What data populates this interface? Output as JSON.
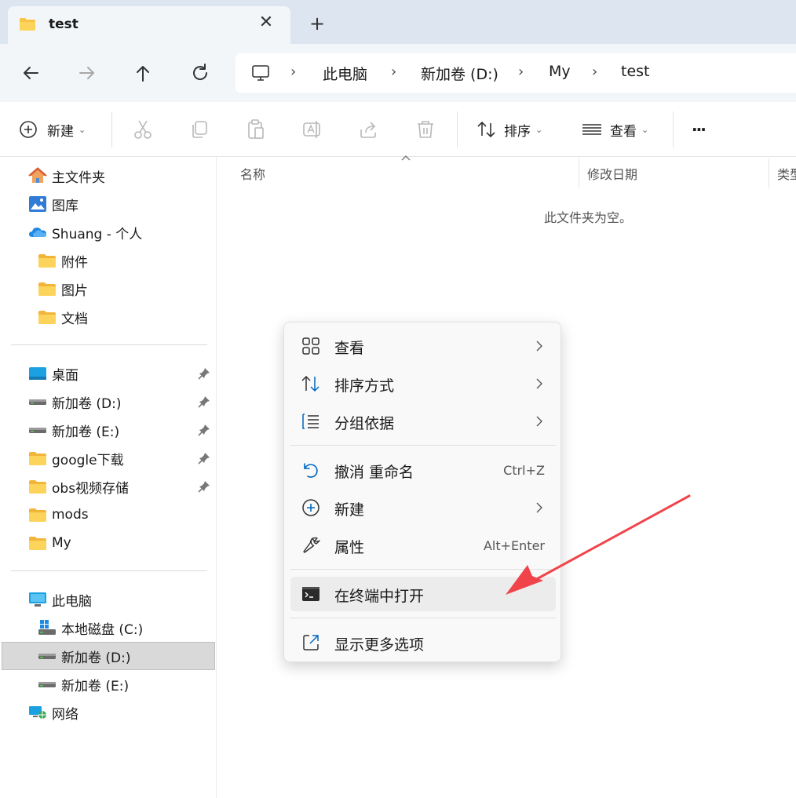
{
  "tab": {
    "title": "test",
    "close": "✕",
    "new": "+"
  },
  "address": {
    "items": [
      "此电脑",
      "新加卷 (D:)",
      "My",
      "test"
    ],
    "separator": "›"
  },
  "toolbar": {
    "new_label": "新建",
    "sort_label": "排序",
    "view_label": "查看",
    "more_label": "···",
    "caret": "⌄"
  },
  "sidebar": {
    "quick": [
      {
        "label": "主文件夹",
        "icon": "home-icon"
      },
      {
        "label": "图库",
        "icon": "gallery-icon"
      },
      {
        "label": "Shuang - 个人",
        "icon": "onedrive-icon"
      },
      {
        "label": "附件",
        "icon": "folder-icon"
      },
      {
        "label": "图片",
        "icon": "folder-icon"
      },
      {
        "label": "文档",
        "icon": "folder-icon"
      }
    ],
    "pinned": [
      {
        "label": "桌面",
        "icon": "desktop-icon",
        "pinned": true
      },
      {
        "label": "新加卷 (D:)",
        "icon": "drive-icon",
        "pinned": true
      },
      {
        "label": "新加卷 (E:)",
        "icon": "drive-icon",
        "pinned": true
      },
      {
        "label": "google下载",
        "icon": "folder-icon",
        "pinned": true
      },
      {
        "label": "obs视频存储",
        "icon": "folder-icon",
        "pinned": true
      },
      {
        "label": "mods",
        "icon": "folder-icon",
        "pinned": false
      },
      {
        "label": "My",
        "icon": "folder-icon",
        "pinned": false
      }
    ],
    "devices": [
      {
        "label": "此电脑",
        "icon": "computer-icon"
      },
      {
        "label": "本地磁盘 (C:)",
        "icon": "windows-drive-icon"
      },
      {
        "label": "新加卷 (D:)",
        "icon": "drive-icon",
        "selected": true
      },
      {
        "label": "新加卷 (E:)",
        "icon": "drive-icon"
      },
      {
        "label": "网络",
        "icon": "network-icon"
      }
    ]
  },
  "content": {
    "columns": [
      "名称",
      "修改日期",
      "类型"
    ],
    "empty_message": "此文件夹为空。"
  },
  "context_menu": {
    "items": [
      {
        "label": "查看",
        "icon": "grid-icon",
        "submenu": true
      },
      {
        "label": "排序方式",
        "icon": "sort-icon",
        "submenu": true
      },
      {
        "label": "分组依据",
        "icon": "group-icon",
        "submenu": true
      },
      {
        "label": "撤消 重命名",
        "icon": "undo-icon",
        "shortcut": "Ctrl+Z"
      },
      {
        "label": "新建",
        "icon": "plus-circle-icon",
        "submenu": true
      },
      {
        "label": "属性",
        "icon": "wrench-icon",
        "shortcut": "Alt+Enter"
      },
      {
        "label": "在终端中打开",
        "icon": "terminal-icon",
        "highlighted": true
      },
      {
        "label": "显示更多选项",
        "icon": "external-icon"
      }
    ]
  },
  "colors": {
    "accent": "#0067c0",
    "folder": "#f8c542",
    "arrow": "#f0444a"
  }
}
